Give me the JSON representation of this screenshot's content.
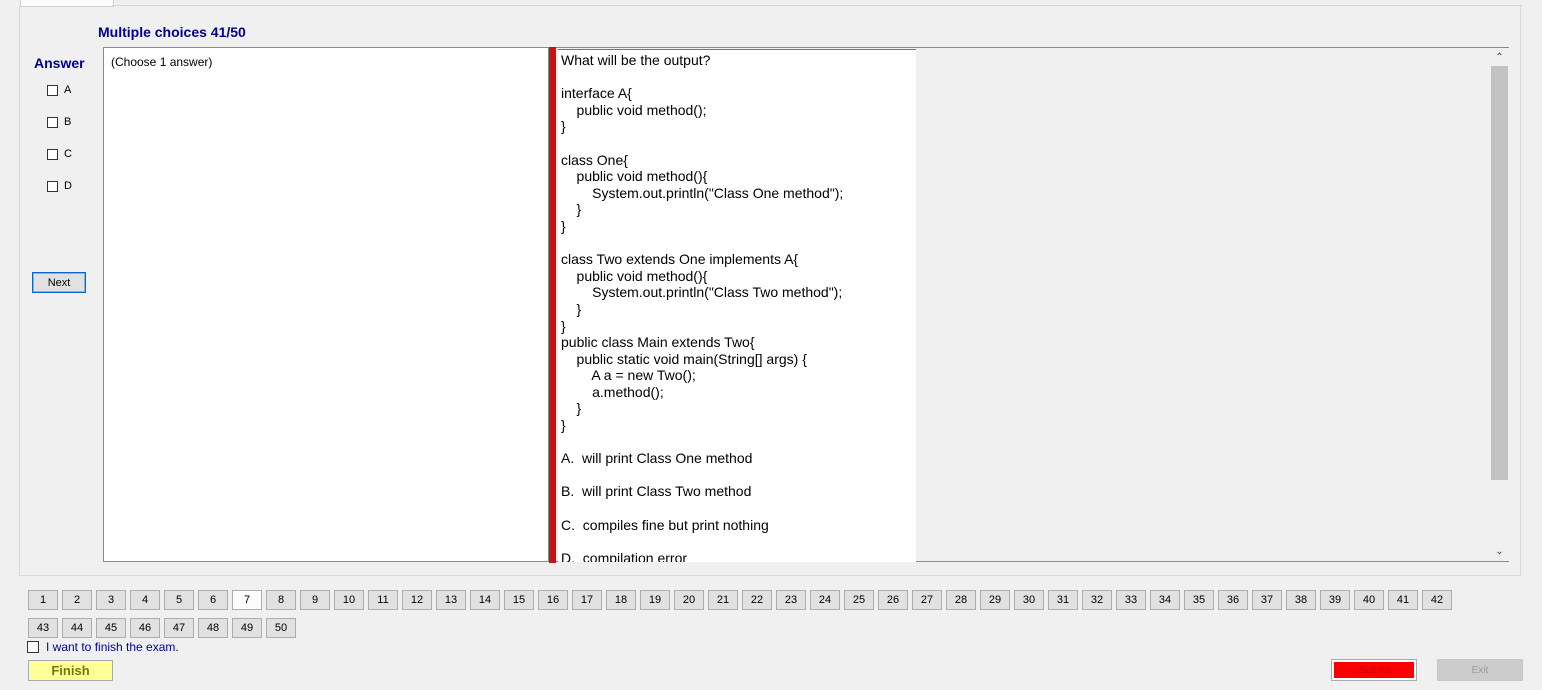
{
  "header": {
    "title": "Multiple choices 41/50"
  },
  "answer_panel": {
    "label": "Answer",
    "options": [
      "A",
      "B",
      "C",
      "D"
    ],
    "next_label": "Next"
  },
  "choose_text": "(Choose 1 answer)",
  "question_lines": [
    "What will be the output?",
    "",
    "interface A{",
    "    public void method();",
    "}",
    "",
    "class One{",
    "    public void method(){",
    "        System.out.println(\"Class One method\");",
    "    }",
    "}",
    "",
    "class Two extends One implements A{",
    "    public void method(){",
    "        System.out.println(\"Class Two method\");",
    "    }",
    "}",
    "public class Main extends Two{",
    "    public static void main(String[] args) {",
    "        A a = new Two();",
    "        a.method();",
    "    }",
    "}",
    "",
    "A.  will print Class One method",
    "",
    "B.  will print Class Two method",
    "",
    "C.  compiles fine but print nothing",
    "",
    "D.  compilation error"
  ],
  "scroll": {
    "up_icon": "chevron-up-icon",
    "down_icon": "chevron-down-icon"
  },
  "question_numbers_row1": [
    "1",
    "2",
    "3",
    "4",
    "5",
    "6",
    "7",
    "8",
    "9",
    "10",
    "11",
    "12",
    "13",
    "14",
    "15",
    "16",
    "17",
    "18",
    "19",
    "20",
    "21",
    "22",
    "23",
    "24",
    "25",
    "26",
    "27",
    "28",
    "29",
    "30",
    "31",
    "32",
    "33",
    "34",
    "35",
    "36",
    "37",
    "38",
    "39",
    "40",
    "41",
    "42"
  ],
  "question_numbers_row2": [
    "43",
    "44",
    "45",
    "46",
    "47",
    "48",
    "49",
    "50"
  ],
  "current_highlight": "7",
  "footer": {
    "finish_check_label": "I want to finish the exam.",
    "finish_label": "Finish",
    "submit_label": "Submit",
    "exit_label": "Exit"
  },
  "colors": {
    "accent_blue": "#00008b",
    "red_bar": "#cc1111",
    "submit_red": "#ff0000",
    "finish_yellow": "#ffff99"
  }
}
